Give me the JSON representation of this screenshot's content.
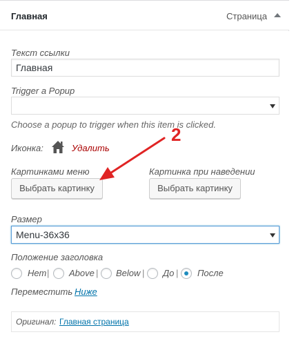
{
  "header": {
    "title": "Главная",
    "item_type": "Страница"
  },
  "link_text": {
    "label": "Текст ссылки",
    "value": "Главная"
  },
  "popup_trigger": {
    "label": "Trigger a Popup",
    "value": "",
    "description": "Choose a popup to trigger when this item is clicked."
  },
  "icon_row": {
    "label": "Иконка:",
    "icon": "home-icon",
    "delete_label": "Удалить"
  },
  "menu_image": {
    "label": "Картинками меню",
    "button_label": "Выбрать картинку"
  },
  "hover_image": {
    "label": "Картинка при наведении",
    "button_label": "Выбрать картинку"
  },
  "size": {
    "label": "Размер",
    "value": "Menu-36x36"
  },
  "title_position": {
    "label": "Положение заголовка",
    "options": [
      "Нет",
      "Above",
      "Below",
      "До",
      "После"
    ],
    "selected": "После"
  },
  "move": {
    "label": "Переместить",
    "link_label": "Ниже"
  },
  "original": {
    "label": "Оригинал:",
    "link_label": "Главная страница"
  },
  "annotation": {
    "number": "2",
    "color": "#e02424"
  }
}
